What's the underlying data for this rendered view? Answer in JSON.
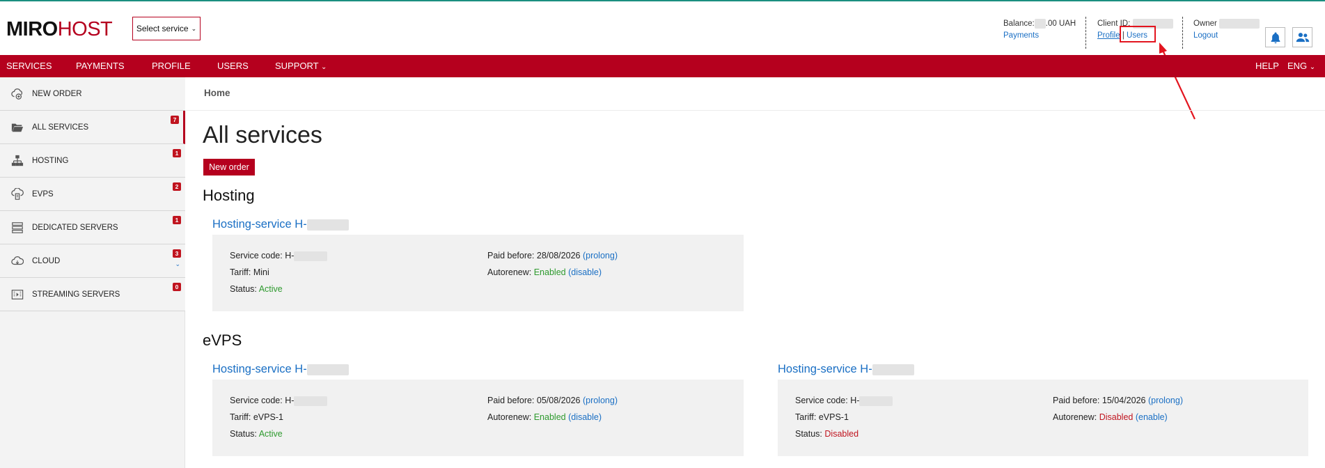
{
  "header": {
    "logo_part1": "MIRO",
    "logo_part2": "HOST",
    "select_service": "Select service",
    "balance_label": "Balance:",
    "balance_suffix": ".00 UAH",
    "payments_link": "Payments",
    "client_id_label": "Client ID:",
    "profile_link": "Profile",
    "separator": "|",
    "users_link": "Users",
    "owner_label": "Owner",
    "logout_link": "Logout"
  },
  "nav": {
    "services": "SERVICES",
    "payments": "PAYMENTS",
    "profile": "PROFILE",
    "users": "USERS",
    "support": "SUPPORT",
    "help": "HELP",
    "lang": "ENG"
  },
  "sidebar": {
    "items": [
      {
        "label": "NEW ORDER",
        "icon": "new-order-icon"
      },
      {
        "label": "ALL SERVICES",
        "icon": "folder-icon",
        "badge": "7"
      },
      {
        "label": "HOSTING",
        "icon": "network-icon",
        "badge": "1"
      },
      {
        "label": "EVPS",
        "icon": "cloud-server-icon",
        "badge": "2"
      },
      {
        "label": "DEDICATED SERVERS",
        "icon": "server-rack-icon",
        "badge": "1"
      },
      {
        "label": "CLOUD",
        "icon": "cloud-icon",
        "badge": "3"
      },
      {
        "label": "STREAMING SERVERS",
        "icon": "streaming-icon",
        "badge": "0"
      }
    ]
  },
  "main": {
    "breadcrumb": "Home",
    "title": "All services",
    "new_order_button": "New order",
    "sections": {
      "hosting": "Hosting",
      "evps": "eVPS"
    },
    "labels": {
      "service_code": "Service code: H-",
      "paid_before": "Paid before:",
      "tariff": "Tariff:",
      "autorenew": "Autorenew:",
      "status": "Status:",
      "service_title_prefix": "Hosting-service H-"
    },
    "cards": [
      {
        "paid_before": "28/08/2026",
        "prolong": "(prolong)",
        "tariff": "Mini",
        "autorenew": "Enabled",
        "autorenew_action": "(disable)",
        "status": "Active"
      },
      {
        "paid_before": "05/08/2026",
        "prolong": "(prolong)",
        "tariff": "eVPS-1",
        "autorenew": "Enabled",
        "autorenew_action": "(disable)",
        "status": "Active"
      },
      {
        "paid_before": "15/04/2026",
        "prolong": "(prolong)",
        "tariff": "eVPS-1",
        "autorenew": "Disabled",
        "autorenew_action": "(enable)",
        "status": "Disabled"
      }
    ]
  },
  "colors": {
    "brand_red": "#b5001e",
    "link_blue": "#1a6fc4",
    "status_green": "#2e9a2e",
    "annotation_red": "#e3151f"
  }
}
